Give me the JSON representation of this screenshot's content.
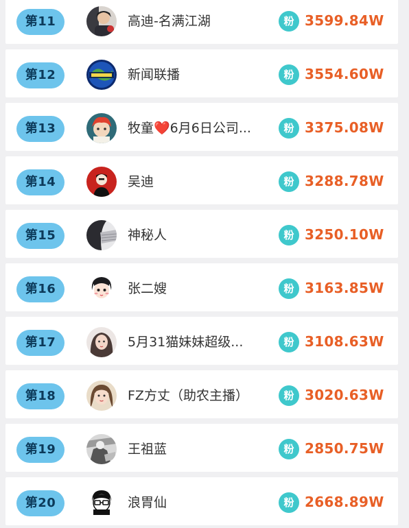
{
  "colors": {
    "rank_badge_bg": "#6dc4ec",
    "rank_text": "#0c3a5a",
    "fan_badge_bg": "#3fc8cc",
    "fan_count": "#e85f26",
    "name_text": "#333333"
  },
  "fan_badge_label": "粉",
  "rows": [
    {
      "rank": "第11",
      "name": "高迪-名满江湖",
      "fans": "3599.84W",
      "avatar_icon": "man-photo-avatar"
    },
    {
      "rank": "第12",
      "name": "新闻联播",
      "fans": "3554.60W",
      "avatar_icon": "news-globe-logo-avatar"
    },
    {
      "rank": "第13",
      "name": "牧童❤️6月6日公司...",
      "fans": "3375.08W",
      "avatar_icon": "cartoon-avatar"
    },
    {
      "rank": "第14",
      "name": "吴迪",
      "fans": "3288.78W",
      "avatar_icon": "red-portrait-avatar"
    },
    {
      "rank": "第15",
      "name": "神秘人",
      "fans": "3250.10W",
      "avatar_icon": "dark-figure-avatar"
    },
    {
      "rank": "第16",
      "name": "张二嫂",
      "fans": "3163.85W",
      "avatar_icon": "cartoon-girl-avatar"
    },
    {
      "rank": "第17",
      "name": "5月31猫妹妹超级...",
      "fans": "3108.63W",
      "avatar_icon": "woman-photo-avatar"
    },
    {
      "rank": "第18",
      "name": "FZ方丈（助农主播）",
      "fans": "3020.63W",
      "avatar_icon": "woman-photo-avatar"
    },
    {
      "rank": "第19",
      "name": "王祖蓝",
      "fans": "2850.75W",
      "avatar_icon": "sketch-photo-avatar"
    },
    {
      "rank": "第20",
      "name": "浪胃仙",
      "fans": "2668.89W",
      "avatar_icon": "cartoon-glasses-avatar"
    }
  ]
}
